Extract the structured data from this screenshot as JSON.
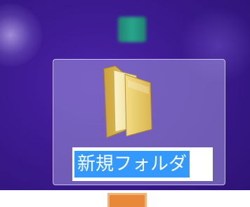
{
  "desktop": {
    "background_color": "#3b1a8f",
    "selection_color": "#3399ff"
  },
  "folder": {
    "icon": "folder-icon",
    "name": "新規フォルダ",
    "state": "renaming"
  },
  "top_icon": {
    "icon": "app-icon",
    "color": "#27b58a"
  },
  "taskbar": {
    "icon": "app-icon",
    "color": "#e8893a"
  }
}
